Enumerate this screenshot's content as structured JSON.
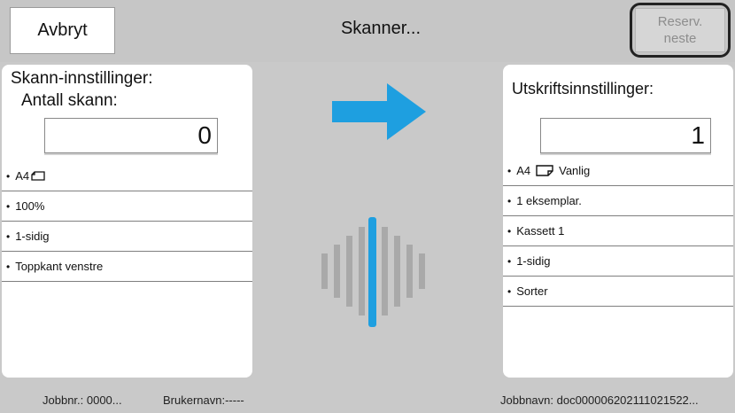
{
  "header": {
    "cancel_label": "Avbryt",
    "title": "Skanner...",
    "reserve_line1": "Reserv.",
    "reserve_line2": "neste"
  },
  "scan_panel": {
    "heading": "Skann-innstillinger:",
    "subheading": "Antall skann:",
    "count": "0",
    "items": [
      {
        "label": "A4",
        "icon": "paper-landscape-icon"
      },
      {
        "label": "100%"
      },
      {
        "label": "1-sidig"
      },
      {
        "label": "Toppkant venstre"
      }
    ]
  },
  "print_panel": {
    "heading": "Utskriftsinnstillinger:",
    "copies": "1",
    "items": [
      {
        "label": "A4",
        "icon": "paper-portrait-icon",
        "extra": "Vanlig"
      },
      {
        "label": "1 eksemplar."
      },
      {
        "label": "Kassett 1"
      },
      {
        "label": "1-sidig"
      },
      {
        "label": "Sorter"
      }
    ]
  },
  "footer": {
    "job_number": "Jobbnr.: 0000...",
    "user_name": "Brukernavn:-----",
    "job_name": "Jobbnavn: doc000006202111021522..."
  },
  "colors": {
    "accent_blue": "#1e9fe0",
    "background": "#c9c9c9",
    "wave_gray": "#a9a9a9"
  }
}
